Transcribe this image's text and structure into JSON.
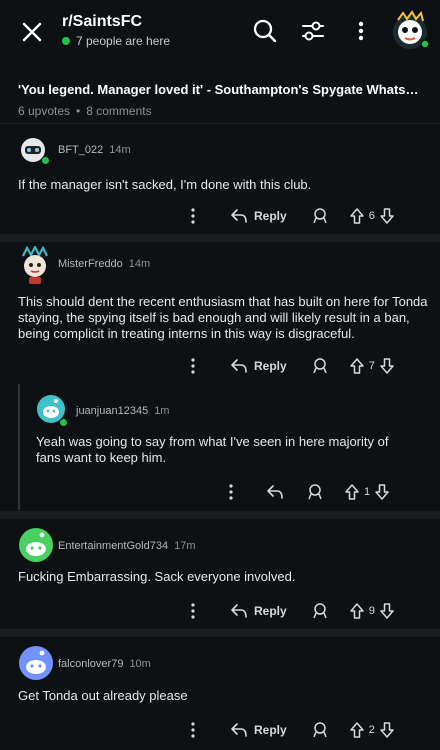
{
  "topbar": {
    "subreddit": "r/SaintsFC",
    "online": "7 people are here",
    "icons": [
      "close-icon",
      "search-icon",
      "filter-icon",
      "more-vertical-icon",
      "user-avatar"
    ]
  },
  "post": {
    "title": "'You legend. Manager loved it' - Southampton's Spygate WhatsAp...",
    "upvotes": "6 upvotes",
    "separator": "•",
    "comments": "8 comments"
  },
  "comments": [
    {
      "author": "BFT_022",
      "time": "14m",
      "body": "If the manager isn't sacked, I'm done with this club.",
      "reply": "Reply",
      "score": "6",
      "avatar_color": "#e8e8e8"
    },
    {
      "author": "MisterFreddo",
      "time": "14m",
      "body": "This should dent the recent enthusiasm that has built on here for Tonda staying, the spying itself is bad enough and will likely result in a ban, being complicit in treating interns in this way is disgraceful.",
      "reply": "Reply",
      "score": "7",
      "avatar_color": "#f0e6d8"
    },
    {
      "author": "juanjuan12345",
      "time": "1m",
      "body": "Yeah was going to say from what I've seen in here majority of fans want to keep him.",
      "score": "1",
      "avatar_color": "#3fc1c9"
    },
    {
      "author": "EntertainmentGold734",
      "time": "17m",
      "body": "Fucking Embarrassing. Sack everyone involved.",
      "reply": "Reply",
      "score": "9",
      "avatar_color": "#46d160"
    },
    {
      "author": "falconlover79",
      "time": "10m",
      "body": "Get Tonda out already please",
      "reply": "Reply",
      "score": "2",
      "avatar_color": "#7193ff"
    }
  ],
  "colors": {
    "background": "#0e1113",
    "divider": "#1a1d20",
    "online": "#22c24b",
    "text": "#d7dadc"
  }
}
